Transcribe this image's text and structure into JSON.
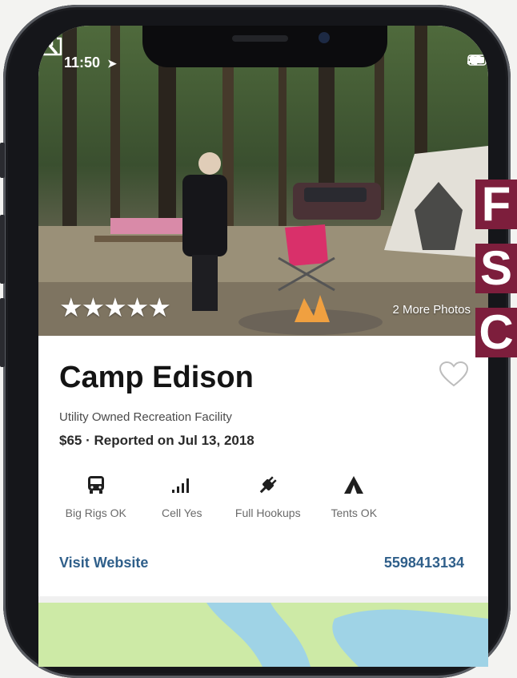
{
  "status_bar": {
    "time": "11:50"
  },
  "hero": {
    "rating_stars": 5,
    "stars_text": "★★★★★",
    "more_photos": "2 More Photos"
  },
  "camp": {
    "name": "Camp Edison",
    "type": "Utility Owned Recreation Facility",
    "price_line": "$65 · Reported on Jul 13, 2018"
  },
  "amenities": [
    {
      "label": "Big Rigs OK",
      "icon": "bus-icon"
    },
    {
      "label": "Cell Yes",
      "icon": "cell-signal-icon"
    },
    {
      "label": "Full Hookups",
      "icon": "plug-icon"
    },
    {
      "label": "Tents OK",
      "icon": "tent-icon"
    }
  ],
  "links": {
    "website": "Visit Website",
    "phone": "5598413134"
  },
  "overlay_letters": [
    "F",
    "S",
    "C"
  ],
  "colors": {
    "link": "#2f5f8a",
    "overlay": "#7d1e3c",
    "map_land": "#cdeaa6",
    "map_water": "#9fd3e6"
  }
}
